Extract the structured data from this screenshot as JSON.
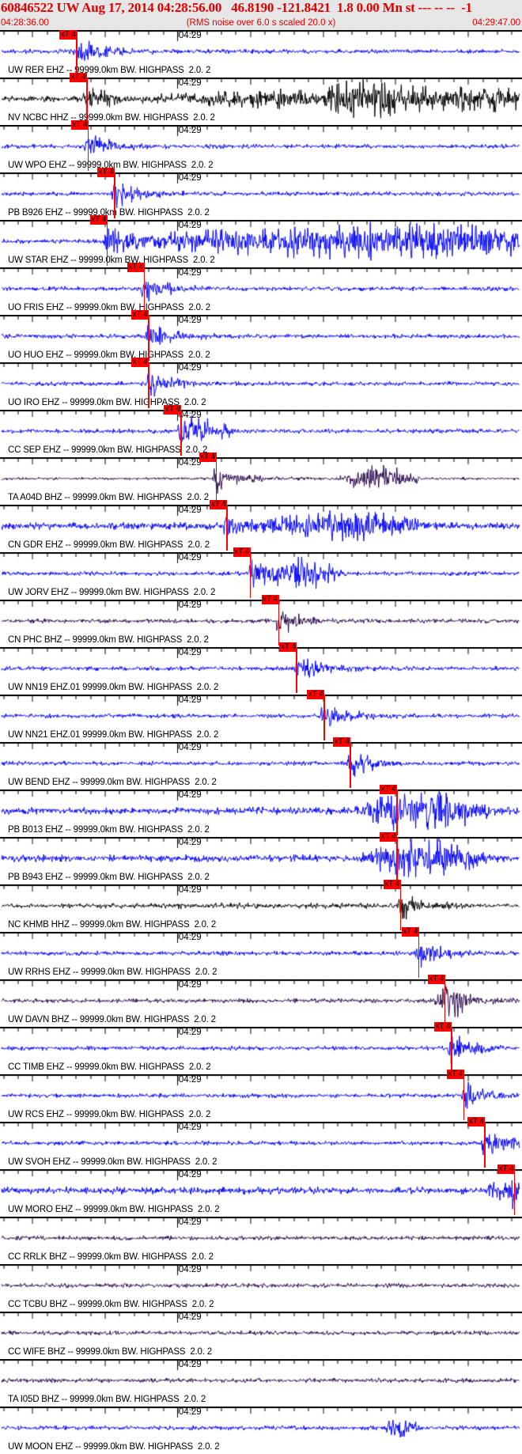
{
  "header": {
    "title": "60846522 UW Aug 17, 2014 04:28:56.00   46.8190 -121.8421  1.8 0.00 Mn st --- -- --  -1",
    "start_time": "04:28:36.00",
    "note": "(RMS noise over 6.0 s scaled 20.0 x)",
    "end_time": "04:29:47.00",
    "color": "#e00000"
  },
  "chart_data": {
    "type": "line",
    "title": "60846522 UW Aug 17, 2014 04:28:56.00",
    "x_range": [
      "04:28:36.00",
      "04:29:47.00"
    ],
    "minute_tick_label": "04:29",
    "pick_label": "xT 4",
    "colors": {
      "blue": "#0000ff",
      "black": "#000000",
      "purple": "#2a0a4a",
      "pick": "#ff0000"
    },
    "traces": [
      {
        "label": "UW RER EHZ -- 99999.0km BW. HIGHPASS  2.0. 2",
        "color": "blue",
        "pick": "04:28:46.1"
      },
      {
        "label": "NV NCBC HHZ -- 99999.0km BW. HIGHPASS  2.0. 2",
        "color": "black",
        "pick": "04:28:47.5"
      },
      {
        "label": "UW WPO EHZ -- 99999.0km BW. HIGHPASS  2.0. 2",
        "color": "blue",
        "pick": "04:28:47.7"
      },
      {
        "label": "PB B926 EHZ -- 99999.0km BW. HIGHPASS  2.0. 2",
        "color": "blue",
        "pick": "04:28:51.3"
      },
      {
        "label": "UW STAR EHZ -- 99999.0km BW. HIGHPASS  2.0. 2",
        "color": "blue",
        "pick": "04:28:50.3"
      },
      {
        "label": "UO FRIS EHZ -- 99999.0km BW. HIGHPASS  2.0. 2",
        "color": "blue",
        "pick": "04:28:55.4"
      },
      {
        "label": "UO HUO EHZ -- 99999.0km BW. HIGHPASS  2.0. 2",
        "color": "blue",
        "pick": "04:28:56.0"
      },
      {
        "label": "UO IRO EHZ -- 99999.0km BW. HIGHPASS  2.0. 2",
        "color": "blue",
        "pick": "04:28:56.0"
      },
      {
        "label": "CC SEP EHZ -- 99999.0km BW. HIGHPASS  2.0. 2",
        "color": "blue",
        "pick": "04:29:00.5"
      },
      {
        "label": "TA A04D BHZ -- 99999.0km BW. HIGHPASS  2.0. 2",
        "color": "purple",
        "pick": "04:29:05.3"
      },
      {
        "label": "CN GDR EHZ -- 99999.0km BW. HIGHPASS  2.0. 2",
        "color": "blue",
        "pick": "04:29:06.8"
      },
      {
        "label": "UW JORV EHZ -- 99999.0km BW. HIGHPASS  2.0. 2",
        "color": "blue",
        "pick": "04:29:10.0"
      },
      {
        "label": "CN PHC BHZ -- 99999.0km BW. HIGHPASS  2.0. 2",
        "color": "purple",
        "pick": "04:29:13.9"
      },
      {
        "label": "UW NN19 EHZ.01 99999.0km BW. HIGHPASS  2.0. 2",
        "color": "blue",
        "pick": "04:29:16.4"
      },
      {
        "label": "UW NN21 EHZ.01 99999.0km BW. HIGHPASS  2.0. 2",
        "color": "blue",
        "pick": "04:29:20.2"
      },
      {
        "label": "UW BEND EHZ -- 99999.0km BW. HIGHPASS  2.0. 2",
        "color": "blue",
        "pick": "04:29:23.8"
      },
      {
        "label": "PB B013 EHZ -- 99999.0km BW. HIGHPASS  2.0. 2",
        "color": "blue",
        "pick": "04:29:30.2"
      },
      {
        "label": "PB B943 EHZ -- 99999.0km BW. HIGHPASS  2.0. 2",
        "color": "blue",
        "pick": "04:29:30.2"
      },
      {
        "label": "NC KHMB HHZ -- 99999.0km BW. HIGHPASS  2.0. 2",
        "color": "black",
        "pick": "04:29:30.7"
      },
      {
        "label": "UW RRHS EHZ -- 99999.0km BW. HIGHPASS  2.0. 2",
        "color": "blue",
        "pick": "04:29:33.2"
      },
      {
        "label": "UW DAVN BHZ -- 99999.0km BW. HIGHPASS  2.0. 2",
        "color": "purple",
        "pick": "04:29:36.8"
      },
      {
        "label": "CC TIMB EHZ -- 99999.0km BW. HIGHPASS  2.0. 2",
        "color": "blue",
        "pick": "04:29:37.7"
      },
      {
        "label": "UW RCS EHZ -- 99999.0km BW. HIGHPASS  2.0. 2",
        "color": "blue",
        "pick": "04:29:39.4"
      },
      {
        "label": "UW SVOH EHZ -- 99999.0km BW. HIGHPASS  2.0. 2",
        "color": "blue",
        "pick": "04:29:42.3"
      },
      {
        "label": "UW MORO EHZ -- 99999.0km BW. HIGHPASS  2.0. 2",
        "color": "blue",
        "pick": "04:29:46.4"
      },
      {
        "label": "CC RRLK BHZ -- 99999.0km BW. HIGHPASS  2.0. 2",
        "color": "purple",
        "pick": null
      },
      {
        "label": "CC TCBU BHZ -- 99999.0km BW. HIGHPASS  2.0. 2",
        "color": "purple",
        "pick": null
      },
      {
        "label": "CC WIFE BHZ -- 99999.0km BW. HIGHPASS  2.0. 2",
        "color": "purple",
        "pick": null
      },
      {
        "label": "TA I05D BHZ -- 99999.0km BW. HIGHPASS  2.0. 2",
        "color": "purple",
        "pick": null
      },
      {
        "label": "UW MOON EHZ -- 99999.0km BW. HIGHPASS  2.0. 2",
        "color": "blue",
        "pick": null
      }
    ]
  }
}
